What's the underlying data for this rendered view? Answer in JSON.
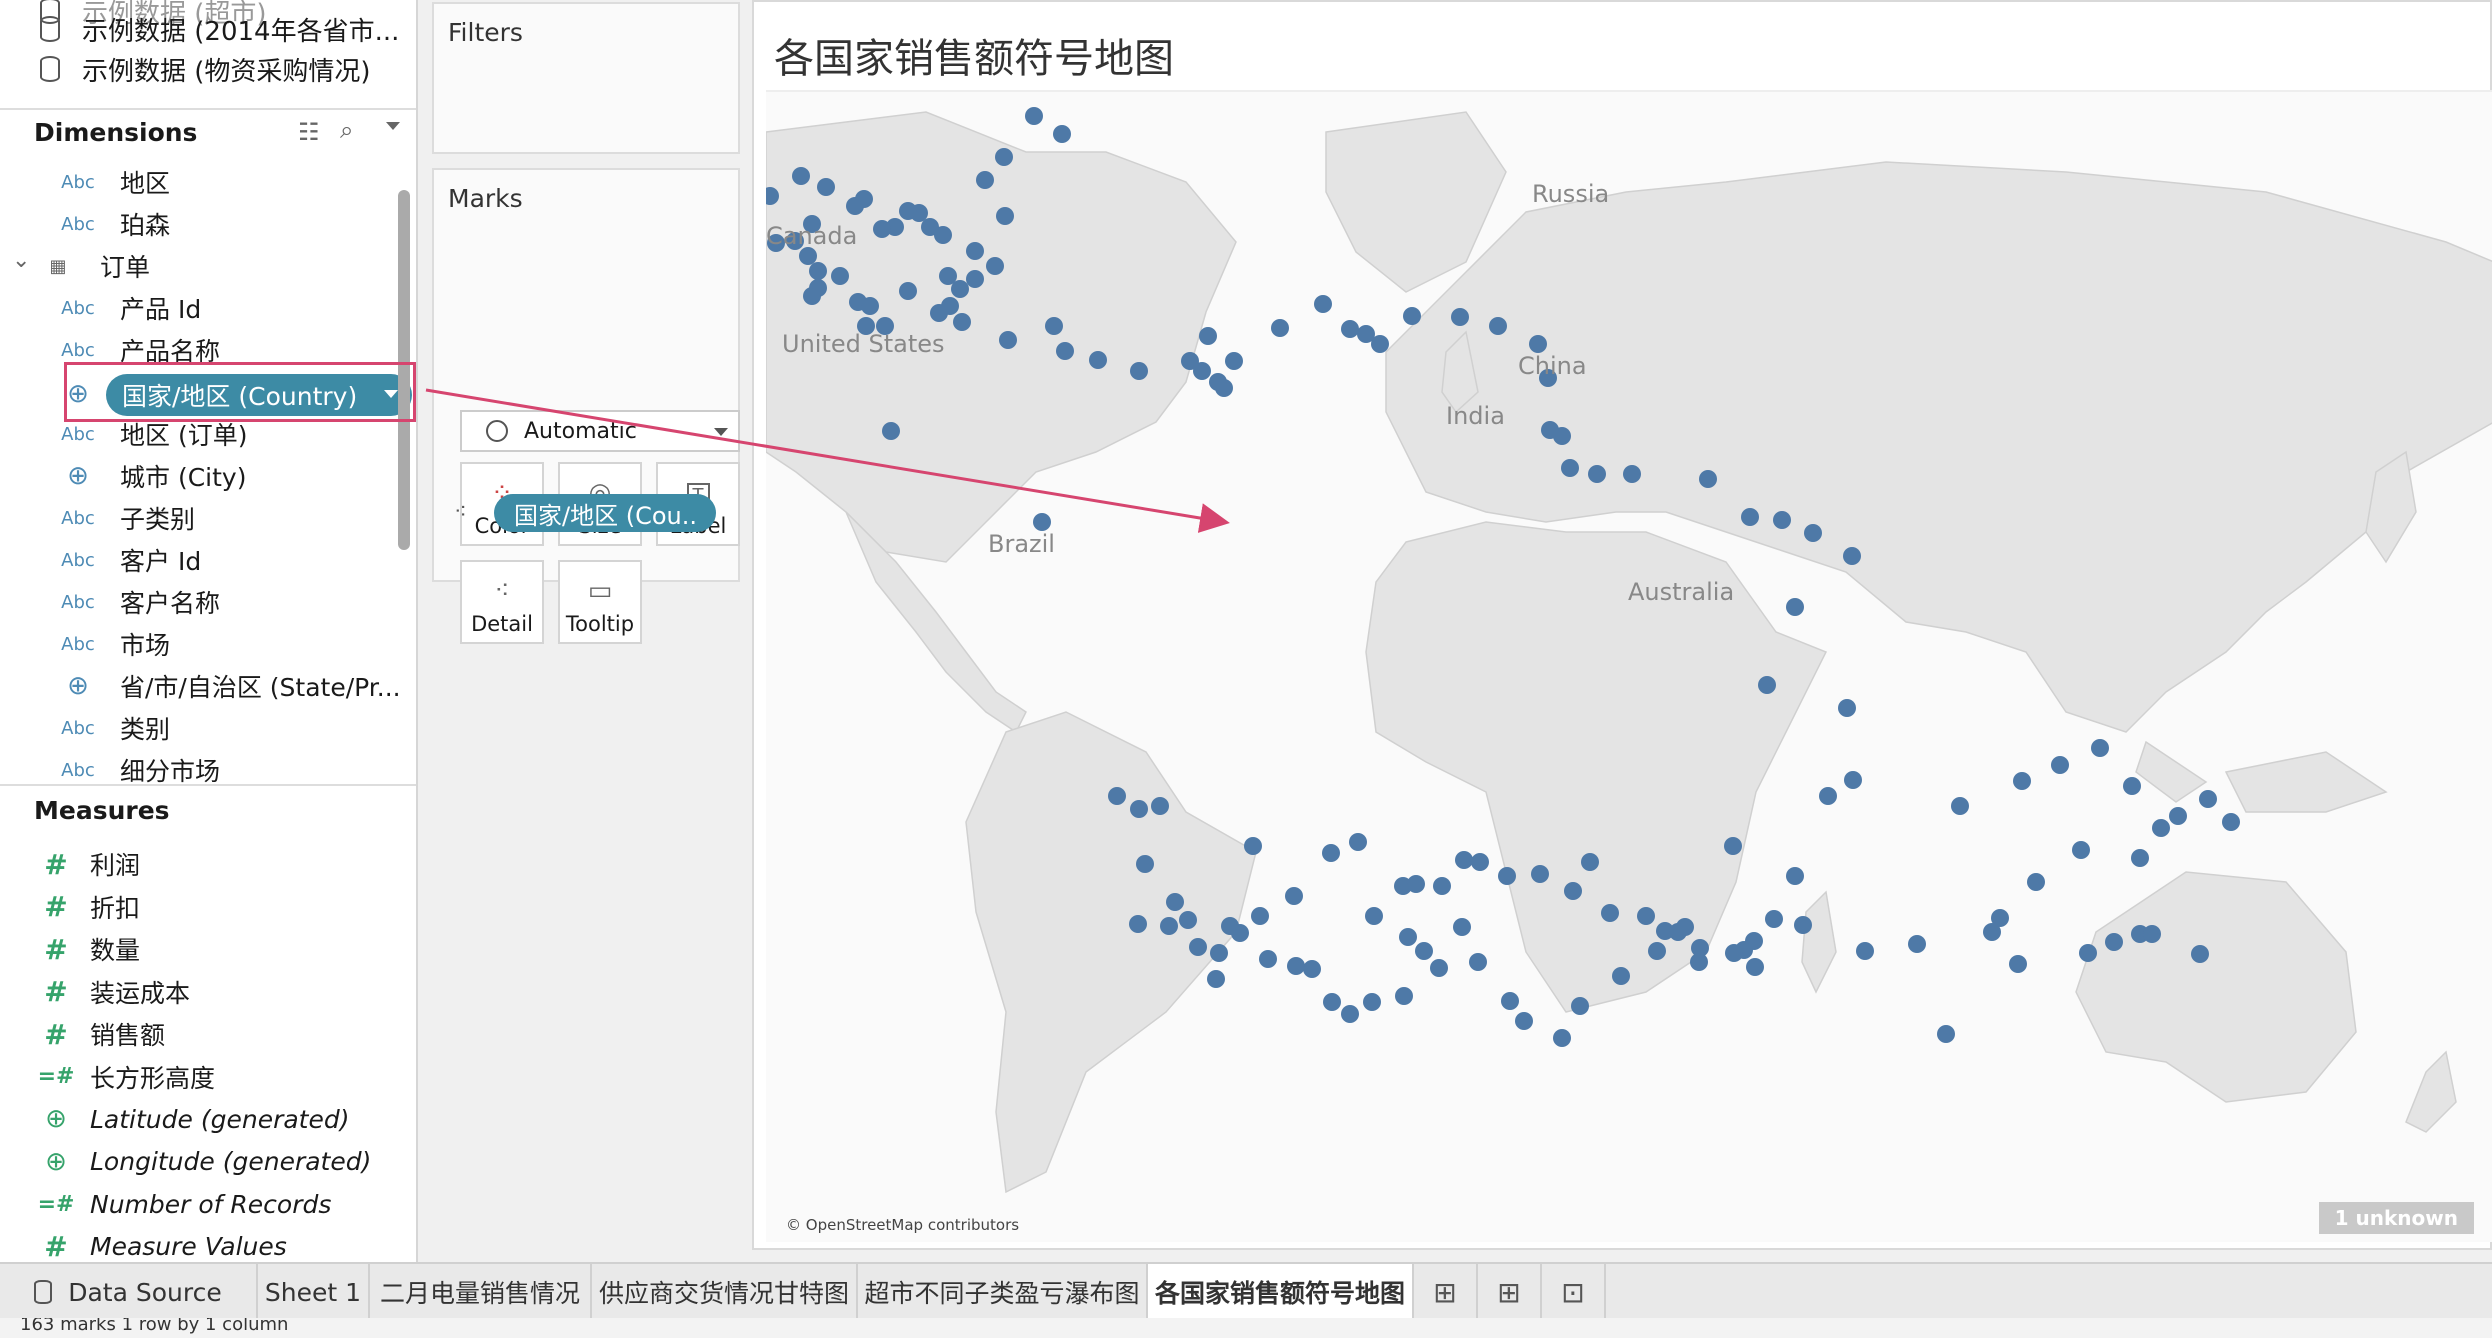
{
  "datasources": [
    "示例数据 (2014年各省市...",
    "示例数据 (物资采购情况)"
  ],
  "dimensions": {
    "header": "Dimensions",
    "fields": [
      {
        "type": "Abc",
        "label": "地区"
      },
      {
        "type": "Abc",
        "label": "珀森"
      },
      {
        "type": "table",
        "label": "订单"
      },
      {
        "type": "Abc",
        "label": "产品 Id"
      },
      {
        "type": "Abc",
        "label": "产品名称"
      },
      {
        "type": "globe",
        "label": "国家/地区 (Country)"
      },
      {
        "type": "Abc",
        "label": "地区 (订单)"
      },
      {
        "type": "globe",
        "label": "城市 (City)"
      },
      {
        "type": "Abc",
        "label": "子类别"
      },
      {
        "type": "Abc",
        "label": "客户 Id"
      },
      {
        "type": "Abc",
        "label": "客户名称"
      },
      {
        "type": "Abc",
        "label": "市场"
      },
      {
        "type": "globe",
        "label": "省/市/自治区 (State/Pr..."
      },
      {
        "type": "Abc",
        "label": "类别"
      },
      {
        "type": "Abc",
        "label": "细分市场"
      }
    ]
  },
  "measures": {
    "header": "Measures",
    "fields": [
      {
        "type": "#",
        "label": "利润",
        "italic": false
      },
      {
        "type": "#",
        "label": "折扣",
        "italic": false
      },
      {
        "type": "#",
        "label": "数量",
        "italic": false
      },
      {
        "type": "#",
        "label": "装运成本",
        "italic": false
      },
      {
        "type": "#",
        "label": "销售额",
        "italic": false
      },
      {
        "type": "=#",
        "label": "长方形高度",
        "italic": false
      },
      {
        "type": "globe",
        "label": "Latitude (generated)",
        "italic": true
      },
      {
        "type": "globe",
        "label": "Longitude (generated)",
        "italic": true
      },
      {
        "type": "=#",
        "label": "Number of Records",
        "italic": true
      },
      {
        "type": "#",
        "label": "Measure Values",
        "italic": true
      }
    ]
  },
  "filters": {
    "title": "Filters"
  },
  "marks": {
    "title": "Marks",
    "type": "Automatic",
    "buttons": [
      "Color",
      "Size",
      "Label",
      "Detail",
      "Tooltip"
    ],
    "pill": "国家/地区 (Cou.."
  },
  "view": {
    "title": "各国家销售额符号地图",
    "map_labels": [
      "Canada",
      "United States",
      "Russia",
      "China",
      "India",
      "Brazil",
      "Australia"
    ],
    "attribution": "© OpenStreetMap contributors",
    "unknown": "1 unknown",
    "mark_color": "#4e79a7"
  },
  "tabs": [
    "Data Source",
    "Sheet 1",
    "二月电量销售情况",
    "供应商交货情况甘特图",
    "超市不同子类盈亏瀑布图",
    "各国家销售额符号地图"
  ],
  "status": "163 marks    1 row by 1 column",
  "colors": {
    "pill": "#3d8ba5",
    "highlight": "#d6456f",
    "arrow": "#d6456f"
  }
}
